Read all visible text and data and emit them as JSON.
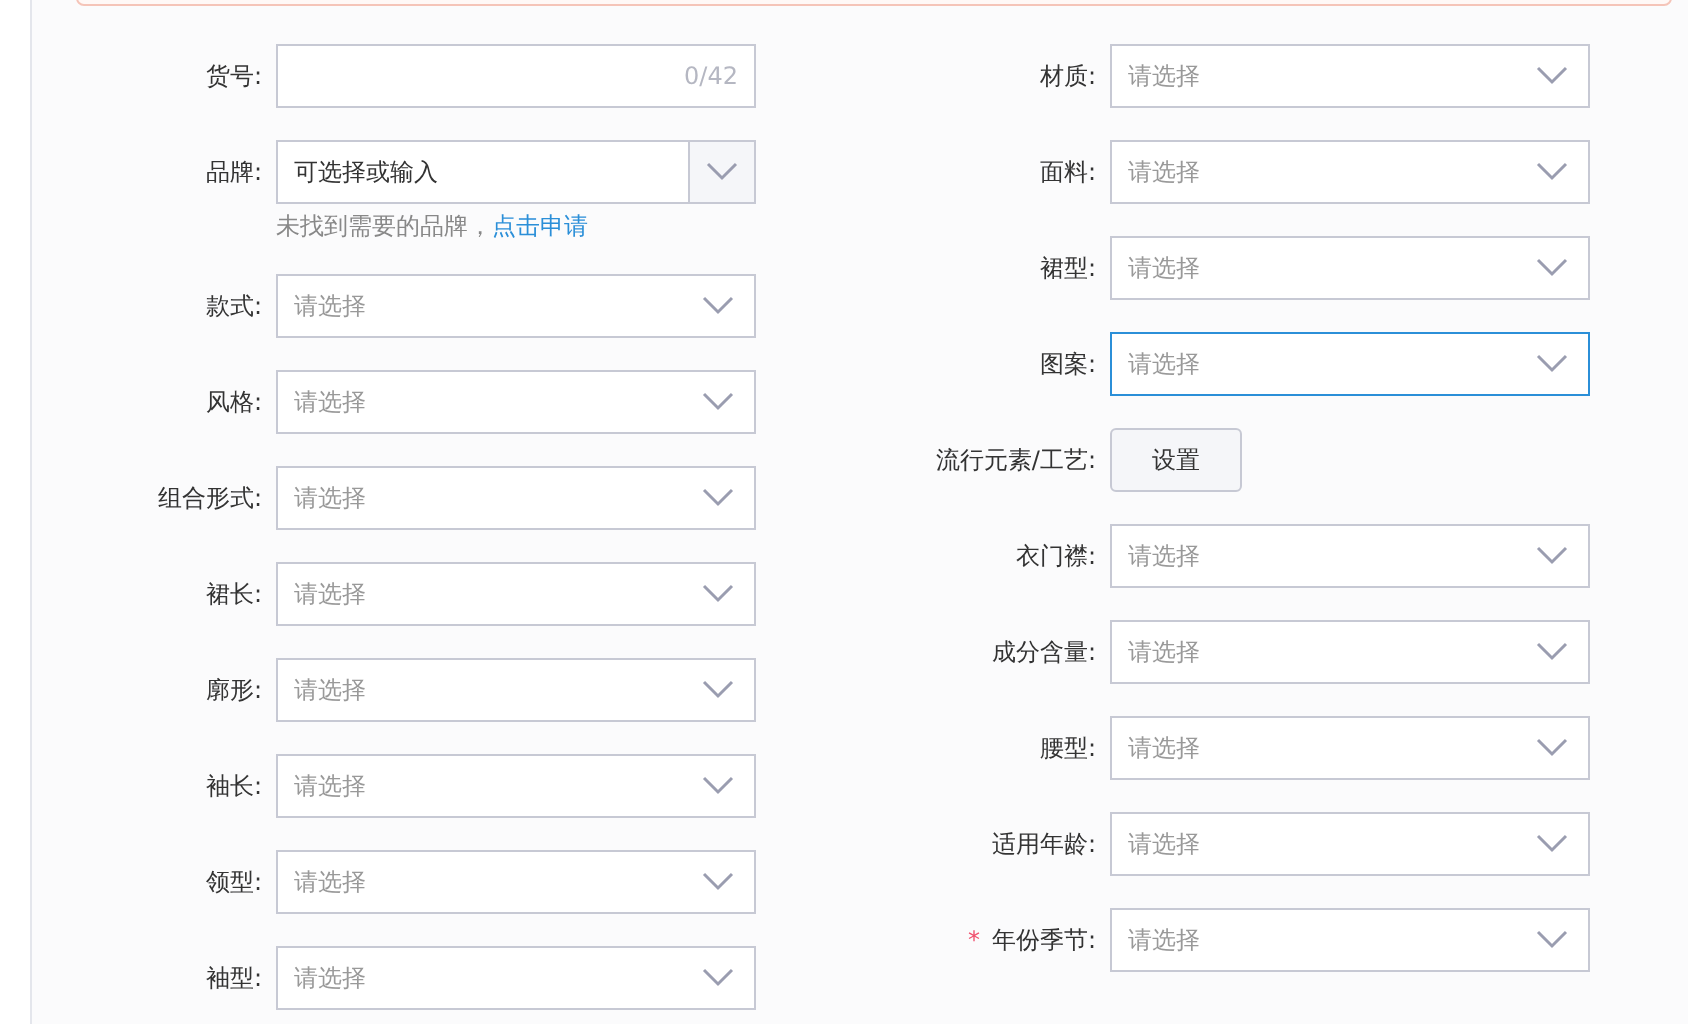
{
  "left_fields": [
    {
      "kind": "text",
      "label": "货号:",
      "counter": "0/42"
    },
    {
      "kind": "combo",
      "label": "品牌:",
      "placeholder": "可选择或输入",
      "help": "未找到需要的品牌，",
      "help_link": "点击申请"
    },
    {
      "kind": "select",
      "label": "款式:",
      "placeholder": "请选择",
      "focused": false
    },
    {
      "kind": "select",
      "label": "风格:",
      "placeholder": "请选择",
      "focused": false
    },
    {
      "kind": "select",
      "label": "组合形式:",
      "placeholder": "请选择",
      "focused": false
    },
    {
      "kind": "select",
      "label": "裙长:",
      "placeholder": "请选择",
      "focused": false
    },
    {
      "kind": "select",
      "label": "廓形:",
      "placeholder": "请选择",
      "focused": false
    },
    {
      "kind": "select",
      "label": "袖长:",
      "placeholder": "请选择",
      "focused": false
    },
    {
      "kind": "select",
      "label": "领型:",
      "placeholder": "请选择",
      "focused": false
    },
    {
      "kind": "select",
      "label": "袖型:",
      "placeholder": "请选择",
      "focused": false
    }
  ],
  "right_fields": [
    {
      "kind": "select",
      "label": "材质:",
      "placeholder": "请选择",
      "focused": false
    },
    {
      "kind": "select",
      "label": "面料:",
      "placeholder": "请选择",
      "focused": false
    },
    {
      "kind": "select",
      "label": "裙型:",
      "placeholder": "请选择",
      "focused": false
    },
    {
      "kind": "select",
      "label": "图案:",
      "placeholder": "请选择",
      "focused": true
    },
    {
      "kind": "button",
      "label": "流行元素/工艺:",
      "button": "设置"
    },
    {
      "kind": "select",
      "label": "衣门襟:",
      "placeholder": "请选择",
      "focused": false
    },
    {
      "kind": "select",
      "label": "成分含量:",
      "placeholder": "请选择",
      "focused": false
    },
    {
      "kind": "select",
      "label": "腰型:",
      "placeholder": "请选择",
      "focused": false
    },
    {
      "kind": "select",
      "label": "适用年龄:",
      "placeholder": "请选择",
      "focused": false
    },
    {
      "kind": "select",
      "label": "年份季节:",
      "required_mark": "*",
      "placeholder": "请选择",
      "focused": false
    }
  ]
}
